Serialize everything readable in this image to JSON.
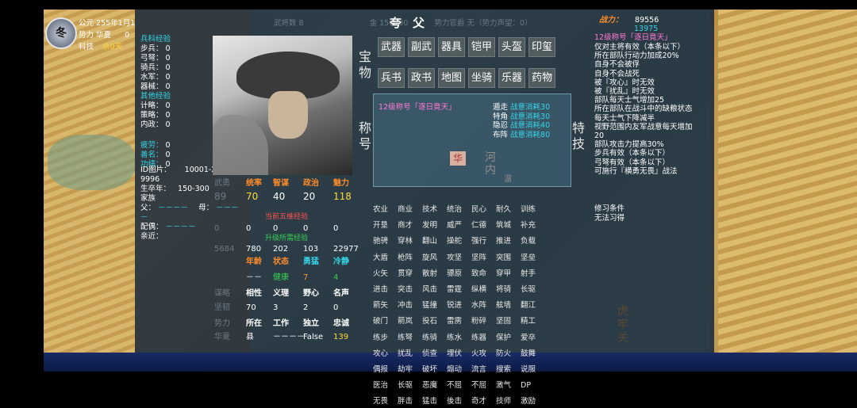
{
  "top_left": {
    "season": "冬",
    "era_label": "公元",
    "era_value": "255年1月1",
    "faction_label": "势力",
    "faction_value": "华夏",
    "faction_extra": "0",
    "tech_label": "科技",
    "tech_value": "余0天"
  },
  "exp": {
    "title": "兵科经验",
    "items": [
      "步兵：",
      "弓弩：",
      "骑兵：",
      "水军：",
      "器械："
    ],
    "values": [
      "0",
      "0",
      "0",
      "0",
      "0"
    ],
    "other_title": "其他经验",
    "other": [
      "计略：",
      "策略：",
      "内政："
    ],
    "other_values": [
      "0",
      "0",
      "0"
    ],
    "status": [
      "疲劳：",
      "善名：",
      "功绩："
    ],
    "status_values": [
      "0",
      "0",
      "0"
    ]
  },
  "id_info": {
    "id_label": "ID图片：",
    "id_value": "10001-2",
    "id_value2": "9996",
    "life_label": "生卒年：",
    "life_value": "150-300",
    "family_label": "家族",
    "father_label": "父：",
    "father_value": "－－－－",
    "mother_label": "母：",
    "mother_value": "－－－",
    "dash": "－",
    "spouse_label": "配偶：",
    "spouse_value": "－－－－",
    "relatives_label": "亲近："
  },
  "character": {
    "name": "夸父",
    "power": "战力：",
    "power_value": "89556",
    "power_value2": "13975"
  },
  "stats": {
    "headers": [
      "统率",
      "智谋",
      "政治",
      "魅力"
    ],
    "values": [
      "70",
      "40",
      "20",
      "118"
    ],
    "five_label": "当前五维经验",
    "five_values": [
      "0",
      "0",
      "0",
      "0"
    ],
    "up_label": "升级所需经验",
    "up_values": [
      "780",
      "202",
      "103",
      "22977"
    ],
    "row3_headers": [
      "年龄",
      "状态",
      "勇猛",
      "冷静"
    ],
    "row3_values": [
      "－－",
      "健康",
      "7",
      "4"
    ],
    "row4_headers": [
      "相性",
      "义理",
      "野心",
      "名声"
    ],
    "row4_values": [
      "70",
      "3",
      "2",
      "0"
    ],
    "row5_headers": [
      "所在",
      "工作",
      "独立",
      "忠诚"
    ],
    "row5_values": [
      "县",
      "－－－－",
      "False",
      "139"
    ],
    "left_labels": [
      "武勇",
      "统帅",
      "",
      "",
      "",
      "",
      "谋略",
      "坚韧",
      "势力",
      "华夏"
    ],
    "left_values": [
      "89",
      "0",
      "5684",
      "",
      "",
      ""
    ]
  },
  "treasure": {
    "label": "宝物",
    "row1": [
      "武器",
      "副武",
      "器具",
      "铠甲",
      "头盔",
      "印玺"
    ],
    "row2": [
      "兵书",
      "政书",
      "地图",
      "坐骑",
      "乐器",
      "药物"
    ]
  },
  "title_section": {
    "label": "称号",
    "title_name": "12级称号「逐日竟天」",
    "skills": [
      "遁走",
      "特角",
      "隐忍",
      "布阵"
    ],
    "costs": [
      "战意消耗30",
      "战意消耗30",
      "战意消耗40",
      "战意消耗80"
    ],
    "map_tag": "华",
    "map_city": "河内",
    "map_small": "温"
  },
  "tech_label": "特技",
  "skill_grid": [
    [
      "农业",
      "商业",
      "技术",
      "统治",
      "民心",
      "耐久",
      "训练"
    ],
    [
      "开垦",
      "商才",
      "发明",
      "威严",
      "仁德",
      "筑城",
      "补充"
    ],
    [
      "驰骋",
      "穿林",
      "翻山",
      "操舵",
      "强行",
      "推进",
      "负载"
    ],
    [
      "大盾",
      "枪阵",
      "旋风",
      "攻坚",
      "坚阵",
      "突围",
      "坚垒"
    ],
    [
      "火矢",
      "贯穿",
      "散射",
      "骠原",
      "致命",
      "穿甲",
      "射手"
    ],
    [
      "进击",
      "突击",
      "风击",
      "雷霆",
      "纵横",
      "将骑",
      "长驱"
    ],
    [
      "箭矢",
      "冲击",
      "猛撞",
      "锐进",
      "水阵",
      "舷墙",
      "翻江"
    ],
    [
      "破门",
      "箭岚",
      "投石",
      "雷雳",
      "粉碎",
      "坚固",
      "精工"
    ],
    [
      "练步",
      "练弩",
      "练骑",
      "练水",
      "练器",
      "保护",
      "爱卒"
    ],
    [
      "攻心",
      "扰乱",
      "侦查",
      "埋伏",
      "火攻",
      "防火",
      "鼓舞"
    ],
    [
      "偶报",
      "劫牢",
      "破坏",
      "煽动",
      "流言",
      "搜索",
      "说服"
    ],
    [
      "医治",
      "长驱",
      "恶魔",
      "不屈",
      "不屈",
      "激气",
      "DP"
    ],
    [
      "无畏",
      "胖击",
      "猛击",
      "後击",
      "奇才",
      "技师",
      "激励"
    ]
  ],
  "right_panel": {
    "title": "12级称号「逐日竟天」",
    "effects": [
      "仅对主将有效（本条以下）",
      "所在部队行动力加成20%",
      "自身不会被俘",
      "自身不会战死",
      "被『攻心』时无效",
      "被『扰乱』时无效",
      "部队每天士气增加25",
      "所在部队在战斗中的缺粮状态",
      "每天士气下降减半",
      "视野范围内友军战意每天增加",
      "20",
      "部队攻击力提高30%",
      "步兵有效（本条以下）",
      "弓弩有效（本条以下）",
      "可施行『横勇无畏』战法"
    ],
    "learn_label": "修习条件",
    "learn_value": "无法习得"
  },
  "map_right": {
    "city": "虎牢关"
  },
  "top_stats": {
    "items": [
      "武将数 8",
      "金 150000",
      "势力官爵 无（势力声望：0）"
    ],
    "items2": [
      "粮 120000",
      "兵 42000",
      "所属 0"
    ]
  }
}
